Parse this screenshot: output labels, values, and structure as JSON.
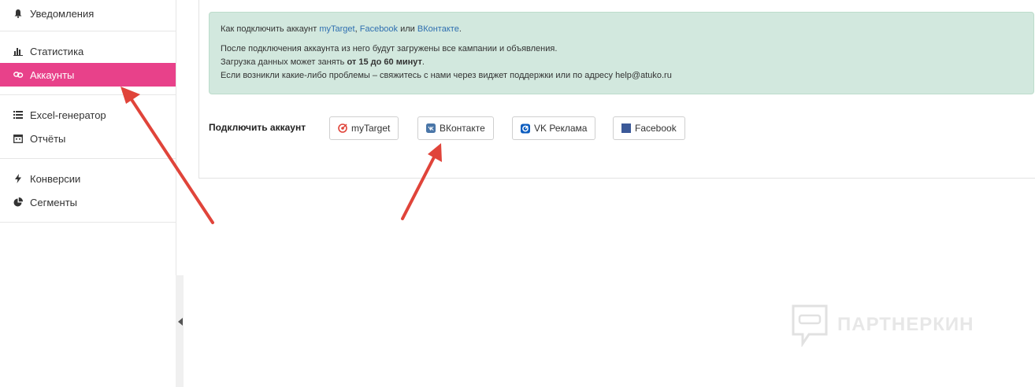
{
  "sidebar": {
    "items": [
      {
        "label": "Уведомления",
        "icon": "bell-icon"
      },
      {
        "label": "Статистика",
        "icon": "bar-chart-icon"
      },
      {
        "label": "Аккаунты",
        "icon": "link-icon",
        "active": true
      },
      {
        "label": "Excel-генератор",
        "icon": "list-icon"
      },
      {
        "label": "Отчёты",
        "icon": "calendar-icon"
      },
      {
        "label": "Конверсии",
        "icon": "lightning-icon"
      },
      {
        "label": "Сегменты",
        "icon": "pie-chart-icon"
      }
    ]
  },
  "alert": {
    "line1_prefix": "Как подключить аккаунт ",
    "link_mytarget": "myTarget",
    "sep_comma": ", ",
    "link_facebook": "Facebook",
    "sep_or": " или ",
    "link_vk": "ВКонтакте",
    "line1_suffix": ".",
    "line2": "После подключения аккаунта из него будут загружены все кампании и объявления.",
    "line3_prefix": "Загрузка данных может занять ",
    "line3_bold": "от 15 до 60 минут",
    "line3_suffix": ".",
    "line4": "Если возникли какие-либо проблемы – свяжитесь с нами через виджет поддержки или по адресу help@atuko.ru"
  },
  "connect": {
    "label": "Подключить аккаунт",
    "buttons": [
      {
        "label": "myTarget",
        "icon": "mytarget-icon"
      },
      {
        "label": "ВКонтакте",
        "icon": "vk-icon"
      },
      {
        "label": "VK Реклама",
        "icon": "vk-ads-icon"
      },
      {
        "label": "Facebook",
        "icon": "facebook-icon"
      }
    ]
  },
  "watermark": {
    "text": "ПАРТНЕРКИН"
  },
  "colors": {
    "accent": "#e8418a",
    "alert_bg": "#d2e8de",
    "link": "#2f6fb0",
    "arrow": "#e0443a"
  }
}
